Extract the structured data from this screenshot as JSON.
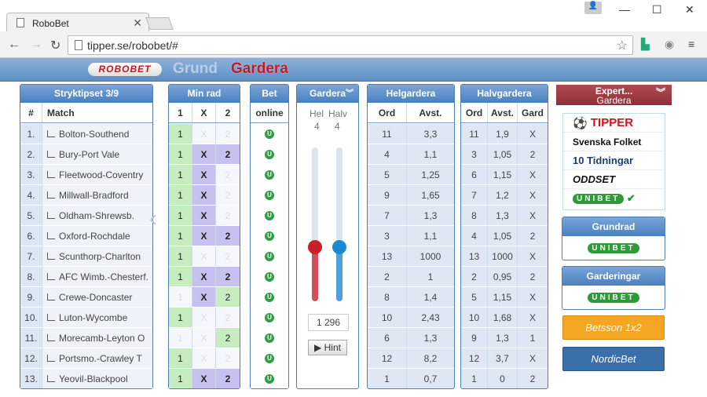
{
  "browser": {
    "tab_title": "RoboBet",
    "url": "tipper.se/robobet/#"
  },
  "app": {
    "logo": "ROBOBET",
    "nav": [
      "Grund",
      "Gardera"
    ]
  },
  "stryk": {
    "title": "Stryktipset 3/9",
    "col_num": "#",
    "col_match": "Match",
    "rows": [
      {
        "n": "1.",
        "m": "Bolton-Southend"
      },
      {
        "n": "2.",
        "m": "Bury-Port Vale"
      },
      {
        "n": "3.",
        "m": "Fleetwood-Coventry"
      },
      {
        "n": "4.",
        "m": "Millwall-Bradford"
      },
      {
        "n": "5.",
        "m": "Oldham-Shrewsb."
      },
      {
        "n": "6.",
        "m": "Oxford-Rochdale"
      },
      {
        "n": "7.",
        "m": "Scunthorp-Charlton"
      },
      {
        "n": "8.",
        "m": "AFC Wimb.-Chesterf."
      },
      {
        "n": "9.",
        "m": "Crewe-Doncaster"
      },
      {
        "n": "10.",
        "m": "Luton-Wycombe"
      },
      {
        "n": "11.",
        "m": "Morecamb-Leyton O"
      },
      {
        "n": "12.",
        "m": "Portsmo.-Crawley T"
      },
      {
        "n": "13.",
        "m": "Yeovil-Blackpool"
      }
    ]
  },
  "minrad": {
    "title": "Min rad",
    "cols": [
      "1",
      "X",
      "2"
    ],
    "rows": [
      [
        "g",
        "e",
        "e"
      ],
      [
        "g",
        "p",
        "p"
      ],
      [
        "g",
        "p",
        "e"
      ],
      [
        "g",
        "p",
        "e"
      ],
      [
        "g",
        "p",
        "e"
      ],
      [
        "g",
        "p",
        "p"
      ],
      [
        "g",
        "e",
        "e"
      ],
      [
        "g",
        "p",
        "p"
      ],
      [
        "e",
        "p",
        "g"
      ],
      [
        "g",
        "e",
        "e"
      ],
      [
        "e",
        "e",
        "g"
      ],
      [
        "g",
        "e",
        "e"
      ],
      [
        "g",
        "p",
        "p"
      ]
    ]
  },
  "bet": {
    "title": "Bet",
    "col": "online"
  },
  "gardera": {
    "title": "Gardera",
    "hel_label": "Hel",
    "halv_label": "Halv",
    "hel_value": "4",
    "halv_value": "4",
    "hel_level": 0.35,
    "halv_level": 0.35,
    "rows_total": "1 296",
    "hint": "Hint",
    "hel_color": "#cc1d2a",
    "halv_color": "#1a8bd1"
  },
  "helgardera": {
    "title": "Helgardera",
    "cols": [
      "Ord",
      "Avst."
    ],
    "rows": [
      [
        "11",
        "3,3"
      ],
      [
        "4",
        "1,1"
      ],
      [
        "5",
        "1,25"
      ],
      [
        "9",
        "1,65"
      ],
      [
        "7",
        "1,3"
      ],
      [
        "3",
        "1,1"
      ],
      [
        "13",
        "1000"
      ],
      [
        "2",
        "1"
      ],
      [
        "8",
        "1,4"
      ],
      [
        "10",
        "2,43"
      ],
      [
        "6",
        "1,3"
      ],
      [
        "12",
        "8,2"
      ],
      [
        "1",
        "0,7"
      ]
    ]
  },
  "halvgardera": {
    "title": "Halvgardera",
    "cols": [
      "Ord",
      "Avst.",
      "Gard"
    ],
    "rows": [
      [
        "11",
        "1,9",
        "X"
      ],
      [
        "3",
        "1,05",
        "2"
      ],
      [
        "6",
        "1,15",
        "X"
      ],
      [
        "7",
        "1,2",
        "X"
      ],
      [
        "8",
        "1,3",
        "X"
      ],
      [
        "4",
        "1,05",
        "2"
      ],
      [
        "13",
        "1000",
        "X"
      ],
      [
        "2",
        "0,95",
        "2"
      ],
      [
        "5",
        "1,15",
        "X"
      ],
      [
        "10",
        "1,68",
        "X"
      ],
      [
        "9",
        "1,3",
        "1"
      ],
      [
        "12",
        "3,7",
        "X"
      ],
      [
        "1",
        "0",
        "2"
      ]
    ]
  },
  "expert": {
    "title": "Expert...",
    "sub": "Gardera"
  },
  "sources": {
    "tipper": "TIPPER",
    "folket": "Svenska Folket",
    "tidningar": "10 Tidningar",
    "oddset": "ODDSET",
    "unibet": "UNIBET"
  },
  "grundrad": {
    "title": "Grundrad",
    "source": "UNIBET"
  },
  "garderingar": {
    "title": "Garderingar",
    "source": "UNIBET"
  },
  "betsson": {
    "label": "Betsson 1x2"
  },
  "nordicbet": {
    "label": "NordicBet"
  },
  "colors": {
    "green_cell": "#c6ecc0",
    "purple_cell": "#c6c2ef",
    "header_blue": "#4a7fbf",
    "brand_red": "#c4161c",
    "unibet_green": "#2e9b38",
    "betsson": "#f5a623",
    "nordicbet": "#3b6faa"
  }
}
